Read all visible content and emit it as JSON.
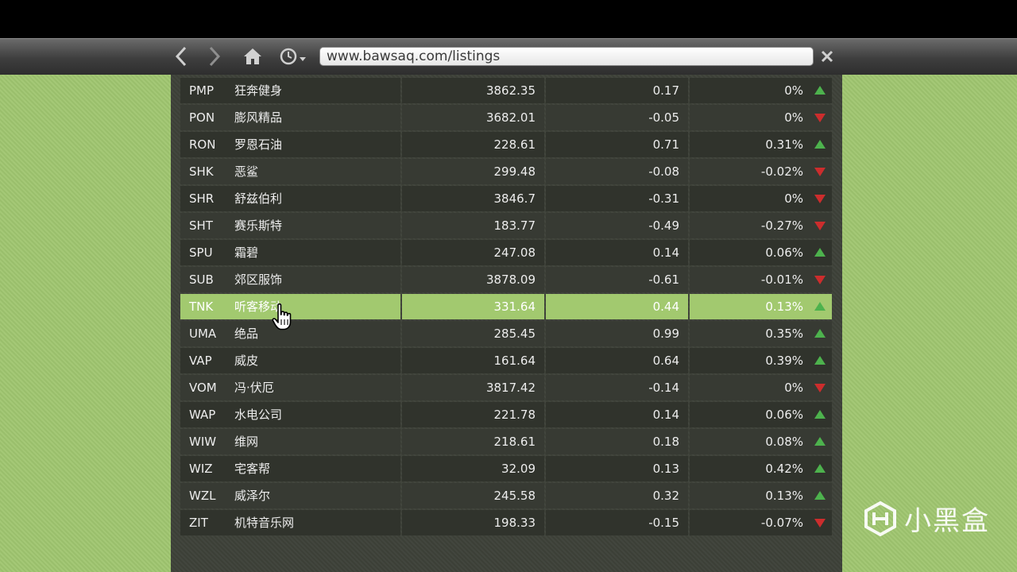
{
  "browser": {
    "url": "www.bawsaq.com/listings",
    "icons": [
      "chevron-left-icon",
      "chevron-right-icon",
      "home-icon",
      "history-clock-icon",
      "close-icon"
    ]
  },
  "colors": {
    "selected_row": "#a2c96f",
    "up_arrow": "#4db24d",
    "down_arrow": "#cc2d2d",
    "side_background": "#9fc56f"
  },
  "listings": [
    {
      "ticker": "PMP",
      "name": "狂奔健身",
      "price": "3862.35",
      "change": "0.17",
      "percent": "0%",
      "trend": "up"
    },
    {
      "ticker": "PON",
      "name": "膨风精品",
      "price": "3682.01",
      "change": "-0.05",
      "percent": "0%",
      "trend": "down"
    },
    {
      "ticker": "RON",
      "name": "罗恩石油",
      "price": "228.61",
      "change": "0.71",
      "percent": "0.31%",
      "trend": "up"
    },
    {
      "ticker": "SHK",
      "name": "恶鲨",
      "price": "299.48",
      "change": "-0.08",
      "percent": "-0.02%",
      "trend": "down"
    },
    {
      "ticker": "SHR",
      "name": "舒兹伯利",
      "price": "3846.7",
      "change": "-0.31",
      "percent": "0%",
      "trend": "down"
    },
    {
      "ticker": "SHT",
      "name": "赛乐斯特",
      "price": "183.77",
      "change": "-0.49",
      "percent": "-0.27%",
      "trend": "down"
    },
    {
      "ticker": "SPU",
      "name": "霜碧",
      "price": "247.08",
      "change": "0.14",
      "percent": "0.06%",
      "trend": "up"
    },
    {
      "ticker": "SUB",
      "name": "郊区服饰",
      "price": "3878.09",
      "change": "-0.61",
      "percent": "-0.01%",
      "trend": "down"
    },
    {
      "ticker": "TNK",
      "name": "听客移动",
      "price": "331.64",
      "change": "0.44",
      "percent": "0.13%",
      "trend": "up",
      "selected": true
    },
    {
      "ticker": "UMA",
      "name": "绝品",
      "price": "285.45",
      "change": "0.99",
      "percent": "0.35%",
      "trend": "up"
    },
    {
      "ticker": "VAP",
      "name": "威皮",
      "price": "161.64",
      "change": "0.64",
      "percent": "0.39%",
      "trend": "up"
    },
    {
      "ticker": "VOM",
      "name": "冯·伏厄",
      "price": "3817.42",
      "change": "-0.14",
      "percent": "0%",
      "trend": "down"
    },
    {
      "ticker": "WAP",
      "name": "水电公司",
      "price": "221.78",
      "change": "0.14",
      "percent": "0.06%",
      "trend": "up"
    },
    {
      "ticker": "WIW",
      "name": "维网",
      "price": "218.61",
      "change": "0.18",
      "percent": "0.08%",
      "trend": "up"
    },
    {
      "ticker": "WIZ",
      "name": "宅客帮",
      "price": "32.09",
      "change": "0.13",
      "percent": "0.42%",
      "trend": "up"
    },
    {
      "ticker": "WZL",
      "name": "威泽尔",
      "price": "245.58",
      "change": "0.32",
      "percent": "0.13%",
      "trend": "up"
    },
    {
      "ticker": "ZIT",
      "name": "机特音乐网",
      "price": "198.33",
      "change": "-0.15",
      "percent": "-0.07%",
      "trend": "down"
    }
  ],
  "watermark": {
    "text": "小黑盒"
  }
}
